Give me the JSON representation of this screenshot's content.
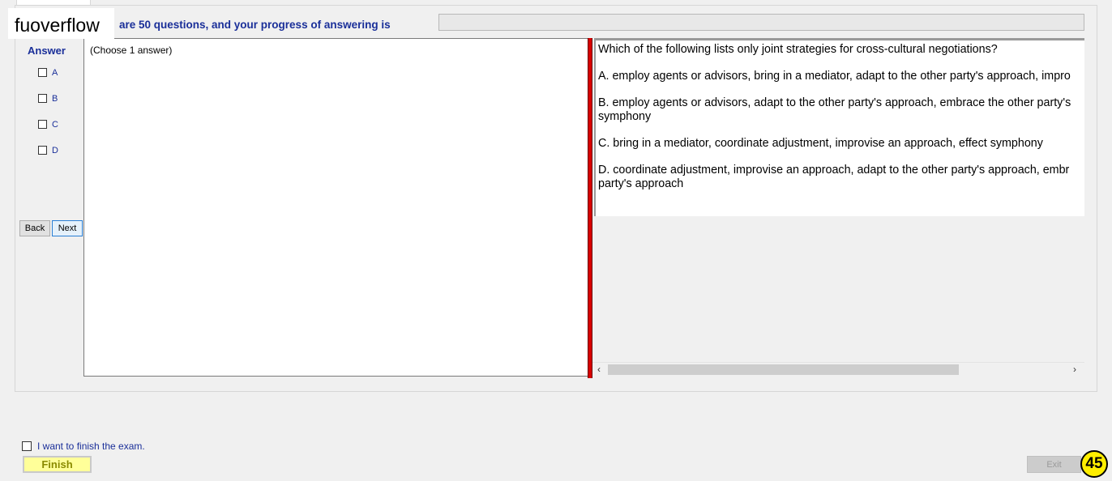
{
  "watermark": "fuoverflow",
  "progress": {
    "text": "are 50 questions, and your progress of answering is",
    "fraction": 0
  },
  "answer_panel": {
    "title": "Answer",
    "options": [
      "A",
      "B",
      "C",
      "D"
    ],
    "back_label": "Back",
    "next_label": "Next"
  },
  "left_pane": {
    "instruction": "(Choose 1 answer)"
  },
  "question": {
    "stem": "Which of the following lists only joint strategies for cross-cultural negotiations?",
    "choice_a": "A.  employ agents or advisors, bring in a mediator, adapt to the other party's approach, impro",
    "choice_b_line1": "B.  employ agents or advisors, adapt to the other party's approach, embrace the other party's",
    "choice_b_line2": "symphony",
    "choice_c": "C.  bring in a mediator, coordinate adjustment, improvise an approach, effect symphony",
    "choice_d_line1": "D.  coordinate adjustment, improvise an approach, adapt to the other party's approach, embr",
    "choice_d_line2": "party's approach"
  },
  "scrollbar": {
    "left_arrow": "‹",
    "right_arrow": "›"
  },
  "footer": {
    "finish_check_label": "I want to finish the exam.",
    "finish_label": "Finish",
    "exit_label": "Exit",
    "page_number": "45"
  },
  "colors": {
    "accent_text": "#1a2f99",
    "splitter": "#d80000",
    "finish_bg": "#ffff99",
    "badge": "#ffee00"
  }
}
